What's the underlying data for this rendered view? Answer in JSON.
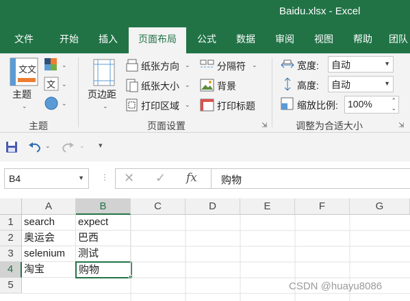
{
  "window": {
    "title": "Baidu.xlsx  -  Excel"
  },
  "menu_tabs": [
    {
      "label": "文件"
    },
    {
      "label": "开始"
    },
    {
      "label": "插入"
    },
    {
      "label": "页面布局"
    },
    {
      "label": "公式"
    },
    {
      "label": "数据"
    },
    {
      "label": "审阅"
    },
    {
      "label": "视图"
    },
    {
      "label": "帮助"
    },
    {
      "label": "团队"
    }
  ],
  "active_tab": "页面布局",
  "ribbon": {
    "themes_group": {
      "label": "主题",
      "theme_button": "主题",
      "theme_icon_text": "文文"
    },
    "page_setup_group": {
      "label": "页面设置",
      "margins": "页边距",
      "orientation": "纸张方向",
      "size": "纸张大小",
      "print_area": "打印区域",
      "breaks": "分隔符",
      "background": "背景",
      "print_titles": "打印标题"
    },
    "scale_group": {
      "label": "调整为合适大小",
      "width_label": "宽度:",
      "width_value": "自动",
      "height_label": "高度:",
      "height_value": "自动",
      "scale_label": "缩放比例:",
      "scale_value": "100%"
    }
  },
  "formula_bar": {
    "name_box": "B4",
    "content": "购物",
    "fx": "fx"
  },
  "sheet": {
    "columns": [
      "A",
      "B",
      "C",
      "D",
      "E",
      "F",
      "G"
    ],
    "rows": [
      "1",
      "2",
      "3",
      "4",
      "5"
    ],
    "selected_column": "B",
    "selected_row": "4",
    "cells": [
      [
        "search",
        "expect"
      ],
      [
        "奥运会",
        "巴西"
      ],
      [
        "selenium",
        "测试"
      ],
      [
        "淘宝",
        "购物"
      ]
    ]
  },
  "watermark": "CSDN @huayu8086",
  "colors": {
    "accent": "#217346"
  }
}
